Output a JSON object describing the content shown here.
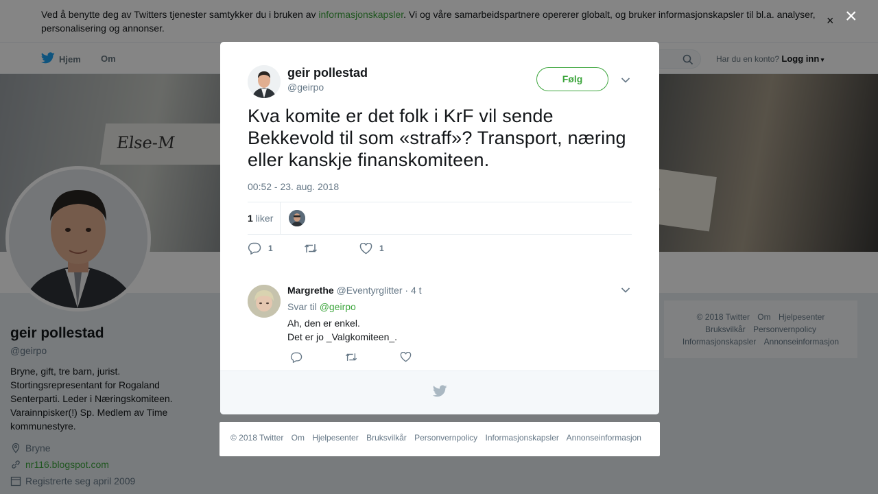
{
  "cookie": {
    "text_before": "Ved å benytte deg av Twitters tjenester samtykker du i bruken av ",
    "link": "informasjonskapsler",
    "text_after": ". Vi og våre samarbeidspartnere opererer globalt, og bruker informasjonskapsler til bl.a. analyser, personalisering og annonser.",
    "close": "×"
  },
  "nav": {
    "home": "Hjem",
    "about": "Om",
    "account_prompt": "Har du en konto?",
    "login": "Logg inn"
  },
  "profile": {
    "name": "geir pollestad",
    "handle": "@geirpo",
    "bio": "Bryne, gift, tre barn, jurist. Stortingsrepresentant for Rogaland Senterparti. Leder i Næringskomiteen. Varainnpisker(!) Sp. Medlem av Time kommunestyre.",
    "location": "Bryne",
    "website": "nr116.blogspot.com",
    "joined": "Registrerte seg april 2009"
  },
  "side_footer": {
    "items": [
      "© 2018 Twitter",
      "Om",
      "Hjelpesenter",
      "Bruksvilkår",
      "Personvernpolicy",
      "Informasjonskapsler",
      "Annonseinformasjon"
    ]
  },
  "overlay": {
    "close": "×"
  },
  "tweet": {
    "name": "geir pollestad",
    "handle": "@geirpo",
    "follow_label": "Følg",
    "text": "Kva komite er det folk i KrF vil sende Bekkevold til som «straff»? Transport, næring eller kanskje finanskomiteen.",
    "timestamp": "00:52 - 23. aug. 2018",
    "likes_count": "1",
    "likes_label": "liker",
    "reply_count": "1",
    "like_count": "1"
  },
  "reply": {
    "name": "Margrethe",
    "handle": "@Eventyrglitter",
    "dot": "·",
    "time": "4 t",
    "reply_to_label": "Svar til",
    "reply_to_handle": "@geirpo",
    "line1": "Ah, den er enkel.",
    "line2": "Det er jo _Valgkomiteen_."
  },
  "bottom_footer": {
    "items": [
      "© 2018 Twitter",
      "Om",
      "Hjelpesenter",
      "Bruksvilkår",
      "Personvernpolicy",
      "Informasjonskapsler",
      "Annonseinformasjon"
    ]
  },
  "colors": {
    "accent": "#3ea63e",
    "twitter_blue": "#1da1f2",
    "muted_text": "#657786",
    "overlay": "rgba(0,0,0,0.48)"
  },
  "icons": [
    "twitter-bird-icon",
    "search-icon",
    "caret-down-icon",
    "chevron-down-icon",
    "reply-icon",
    "retweet-icon",
    "heart-icon",
    "location-icon",
    "link-icon",
    "calendar-icon",
    "close-icon"
  ]
}
